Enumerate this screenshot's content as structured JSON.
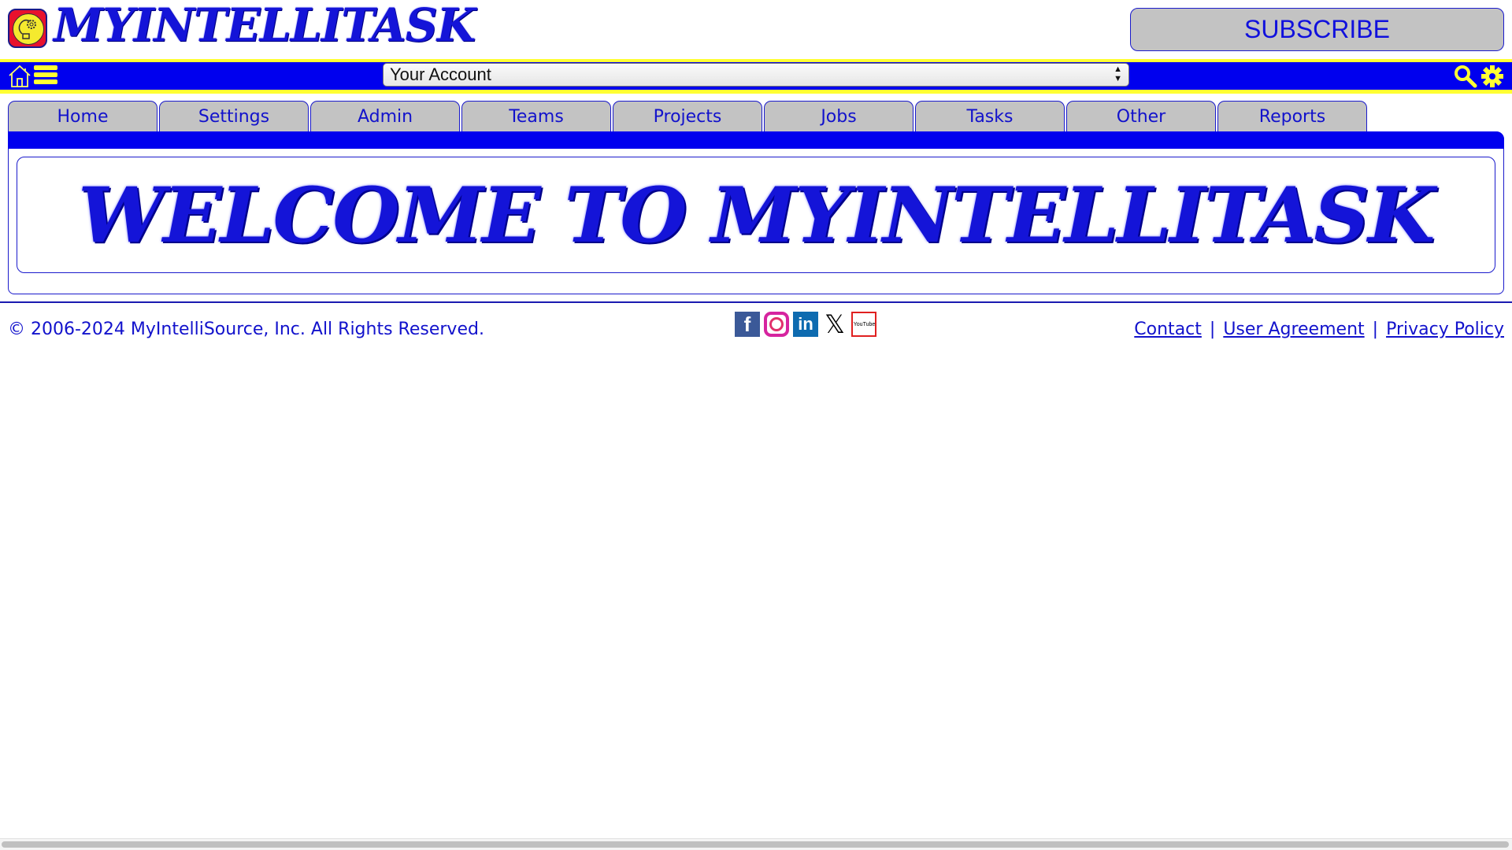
{
  "header": {
    "brand": "MYINTELLITASK",
    "subscribe_label": "SUBSCRIBE"
  },
  "navbar": {
    "account_select_value": "Your Account",
    "icons": [
      "home-icon",
      "menu-icon",
      "search-icon",
      "gear-icon"
    ]
  },
  "tabs": [
    {
      "label": "Home"
    },
    {
      "label": "Settings"
    },
    {
      "label": "Admin"
    },
    {
      "label": "Teams"
    },
    {
      "label": "Projects"
    },
    {
      "label": "Jobs"
    },
    {
      "label": "Tasks"
    },
    {
      "label": "Other"
    },
    {
      "label": "Reports"
    }
  ],
  "main": {
    "welcome": "WELCOME TO MYINTELLITASK"
  },
  "footer": {
    "copyright": "© 2006-2024 MyIntelliSource, Inc. All Rights Reserved.",
    "social": {
      "facebook": "f",
      "linkedin": "in",
      "x": "𝕏",
      "youtube": "YouTube"
    },
    "links": {
      "contact": "Contact",
      "user_agreement": "User Agreement",
      "privacy_policy": "Privacy Policy",
      "separator": "|"
    }
  },
  "colors": {
    "brand_blue": "#0000ee",
    "accent_yellow": "#ffff33",
    "tab_gray": "#c3c3c3"
  }
}
